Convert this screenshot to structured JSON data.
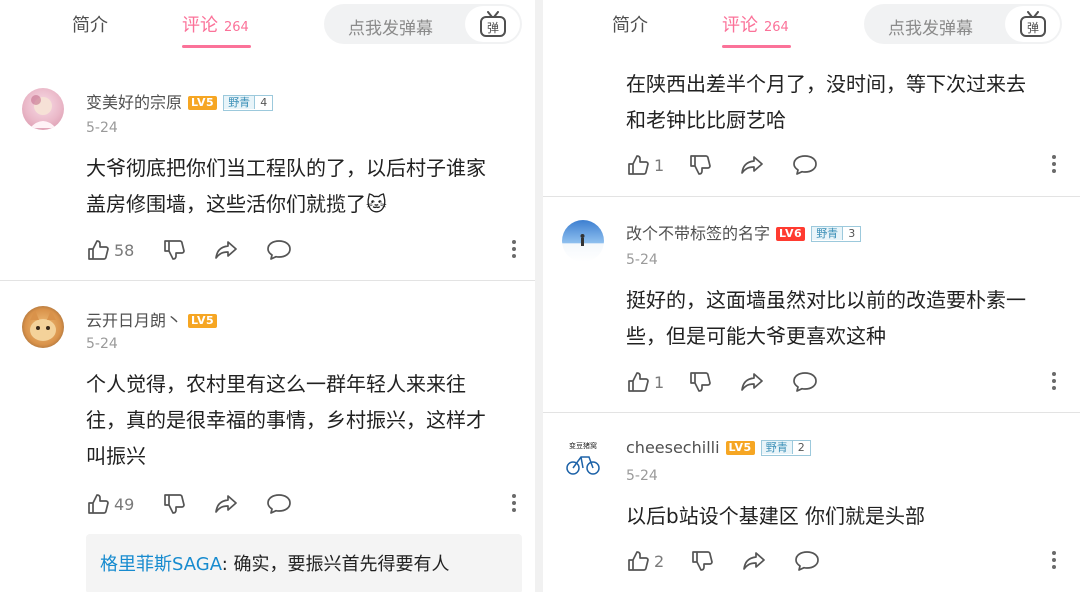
{
  "left_panel": {
    "header": {
      "tab_intro": "简介",
      "tab_comments": "评论",
      "comments_count": "264",
      "danmaku_placeholder": "点我发弹幕",
      "danmaku_button": "弹"
    },
    "comments": [
      {
        "username": "变美好的宗原",
        "level": "LV5",
        "badge_name": "野青",
        "badge_level": "4",
        "date": "5-24",
        "text_lines": [
          "大爷彻底把你们当工程队的了，以后村子谁家",
          "盖房修围墙，这些活你们就揽了"
        ],
        "emoji": "🐱",
        "likes": "58"
      },
      {
        "username": "云开日月朗丶",
        "level": "LV5",
        "date": "5-24",
        "text_lines": [
          "个人觉得，农村里有这么一群年轻人来来往",
          "往，真的是很幸福的事情，乡村振兴，这样才",
          "叫振兴"
        ],
        "likes": "49",
        "reply": {
          "user": "格里菲斯SAGA",
          "text": ": 确实，要振兴首先得要有人"
        }
      }
    ]
  },
  "right_panel": {
    "header": {
      "tab_intro": "简介",
      "tab_comments": "评论",
      "comments_count": "264",
      "danmaku_placeholder": "点我发弹幕",
      "danmaku_button": "弹"
    },
    "partial_comment": {
      "text_lines": [
        "在陕西出差半个月了，没时间，等下次过来去",
        "和老钟比比厨艺哈"
      ],
      "likes": "1"
    },
    "comments": [
      {
        "username": "改个不带标签的名字",
        "level": "LV6",
        "badge_name": "野青",
        "badge_level": "3",
        "date": "5-24",
        "text_lines": [
          "挺好的，这面墙虽然对比以前的改造要朴素一",
          "些，但是可能大爷更喜欢这种"
        ],
        "likes": "1"
      },
      {
        "username": "cheesechilli",
        "level": "LV5",
        "badge_name": "野青",
        "badge_level": "2",
        "date": "5-24",
        "avatar_text": "变豆猪窝",
        "text_lines": [
          "以后b站设个基建区  你们就是头部"
        ],
        "likes": "2"
      }
    ]
  },
  "colors": {
    "accent_pink": "#fb7299",
    "level_orange": "#f6a623",
    "level_red": "#ff3b30",
    "link_blue": "#178bcf"
  },
  "icons": [
    "thumb-up-icon",
    "thumb-down-icon",
    "share-icon",
    "comment-icon",
    "more-dots-icon",
    "danmaku-tv-icon"
  ]
}
